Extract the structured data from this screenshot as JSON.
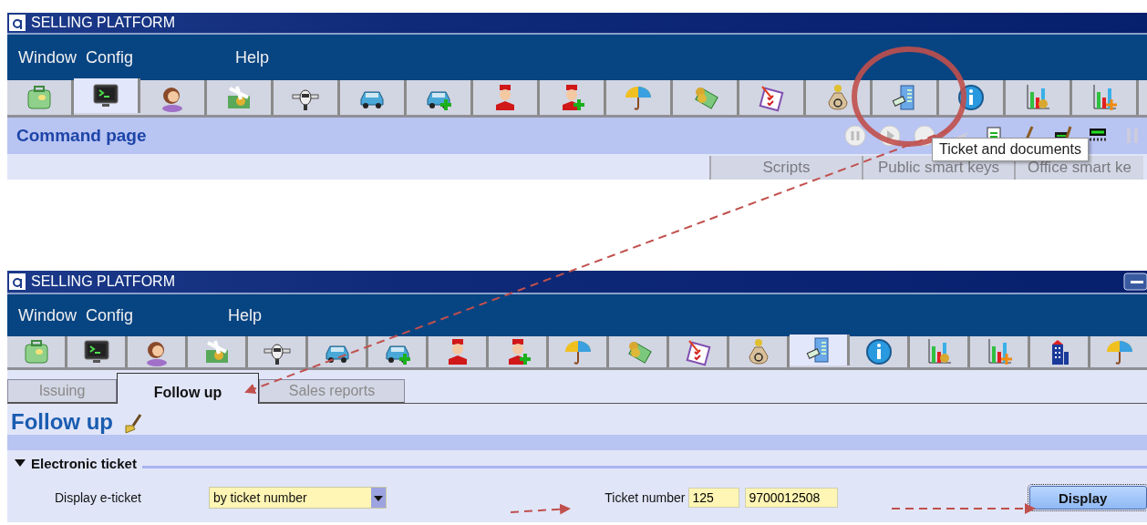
{
  "top_window": {
    "title": "SELLING PLATFORM",
    "menu": [
      "Window",
      "Config",
      "Help"
    ],
    "toolbar": [
      {
        "kind": "suitcase",
        "selected": false
      },
      {
        "kind": "terminal",
        "selected": true
      },
      {
        "kind": "agent",
        "selected": false
      },
      {
        "kind": "plane-money",
        "selected": false
      },
      {
        "kind": "plane",
        "selected": false
      },
      {
        "kind": "car",
        "selected": false
      },
      {
        "kind": "car-add",
        "selected": false
      },
      {
        "kind": "bellboy",
        "selected": false
      },
      {
        "kind": "bellboy-add",
        "selected": false
      },
      {
        "kind": "umbrella",
        "selected": false
      },
      {
        "kind": "money",
        "selected": false
      },
      {
        "kind": "checklist",
        "selected": false
      },
      {
        "kind": "moneybag",
        "selected": false
      },
      {
        "kind": "ticket-machine",
        "selected": false
      },
      {
        "kind": "info",
        "selected": false
      },
      {
        "kind": "chart-money",
        "selected": false
      },
      {
        "kind": "chart-add",
        "selected": false
      }
    ],
    "page_title": "Command page",
    "tabs": [
      {
        "label": "Scripts",
        "selected": false
      },
      {
        "label": "Public smart keys",
        "selected": false
      },
      {
        "label": "Office smart ke",
        "selected": false
      }
    ],
    "tooltip": "Ticket and documents"
  },
  "bottom_window": {
    "title": "SELLING PLATFORM",
    "menu": [
      "Window",
      "Config",
      "Help"
    ],
    "toolbar": [
      {
        "kind": "suitcase",
        "selected": false
      },
      {
        "kind": "terminal",
        "selected": false
      },
      {
        "kind": "agent",
        "selected": false
      },
      {
        "kind": "plane-money",
        "selected": false
      },
      {
        "kind": "plane",
        "selected": false
      },
      {
        "kind": "car",
        "selected": false
      },
      {
        "kind": "car-add",
        "selected": false
      },
      {
        "kind": "bellboy",
        "selected": false
      },
      {
        "kind": "bellboy-add",
        "selected": false
      },
      {
        "kind": "umbrella",
        "selected": false
      },
      {
        "kind": "money",
        "selected": false
      },
      {
        "kind": "checklist",
        "selected": false
      },
      {
        "kind": "moneybag",
        "selected": false
      },
      {
        "kind": "ticket-machine",
        "selected": true
      },
      {
        "kind": "info",
        "selected": false
      },
      {
        "kind": "chart-money",
        "selected": false
      },
      {
        "kind": "chart-add",
        "selected": false
      },
      {
        "kind": "building",
        "selected": false
      },
      {
        "kind": "umbrella",
        "selected": false
      }
    ],
    "tabs": [
      {
        "label": "Issuing",
        "selected": false
      },
      {
        "label": "Follow up",
        "selected": true
      },
      {
        "label": "Sales reports",
        "selected": false
      }
    ],
    "heading": "Follow up",
    "section": {
      "title": "Electronic ticket",
      "expanded": true,
      "display_label": "Display e-ticket",
      "display_mode": "by ticket number",
      "ticket_label": "Ticket number",
      "airline_code": "125",
      "ticket_serial": "9700012508",
      "button": "Display"
    }
  }
}
